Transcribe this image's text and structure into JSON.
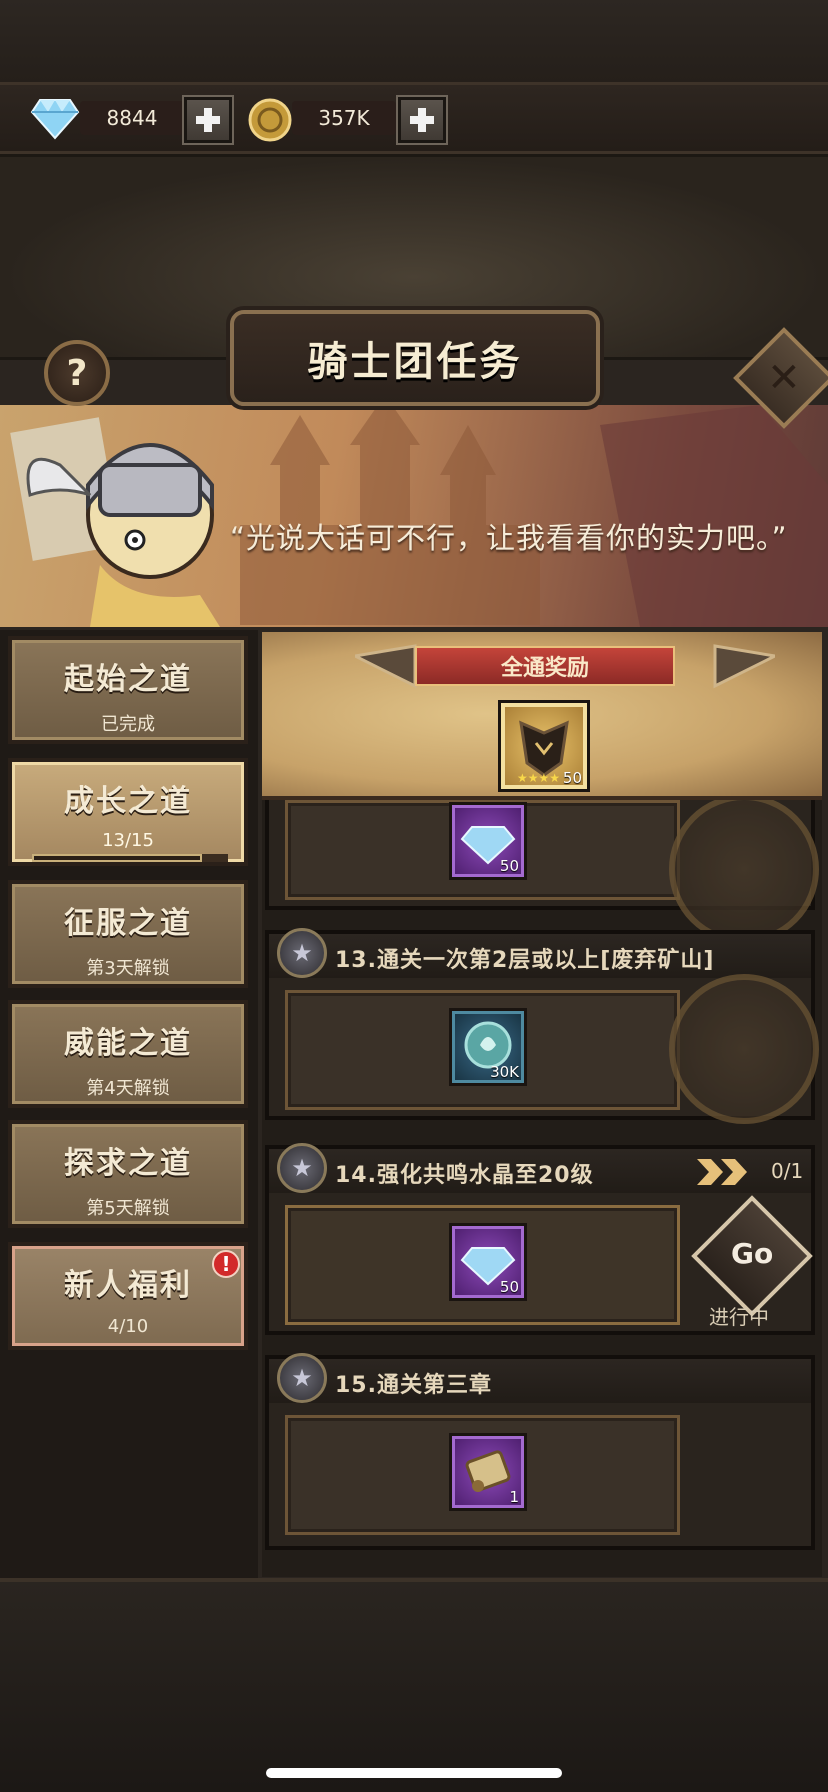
{
  "resources": {
    "diamonds": "8844",
    "gold": "357K"
  },
  "header": {
    "title": "骑士团任务"
  },
  "banner": {
    "quote": "“光说大话可不行，让我看看你的实力吧。”"
  },
  "sidebar": {
    "tabs": [
      {
        "name": "起始之道",
        "sub": "已完成"
      },
      {
        "name": "成长之道",
        "sub": "13/15"
      },
      {
        "name": "征服之道",
        "sub": "第3天解锁"
      },
      {
        "name": "威能之道",
        "sub": "第4天解锁"
      },
      {
        "name": "探求之道",
        "sub": "第5天解锁"
      },
      {
        "name": "新人福利",
        "sub": "4/10",
        "badge": "!"
      }
    ],
    "progress_fraction": 0.867
  },
  "full_reward": {
    "label": "全通奖励",
    "item_qty": "50"
  },
  "tasks": [
    {
      "title": "",
      "reward_qty": "50",
      "reward_icon": "diamond-icon"
    },
    {
      "title": "13.通关一次第2层或以上[废弃矿山]",
      "reward_qty": "30K",
      "reward_icon": "crystal-orb-icon"
    },
    {
      "title": "14.强化共鸣水晶至20级",
      "progress": "0/1",
      "reward_qty": "50",
      "reward_icon": "diamond-icon",
      "go_label": "Go",
      "status": "进行中"
    },
    {
      "title": "15.通关第三章",
      "reward_qty": "1",
      "reward_icon": "scroll-icon"
    }
  ],
  "colors": {
    "accent_gold": "#c9a36d",
    "ribbon_red": "#c4443a",
    "badge_red": "#d22a2a"
  }
}
